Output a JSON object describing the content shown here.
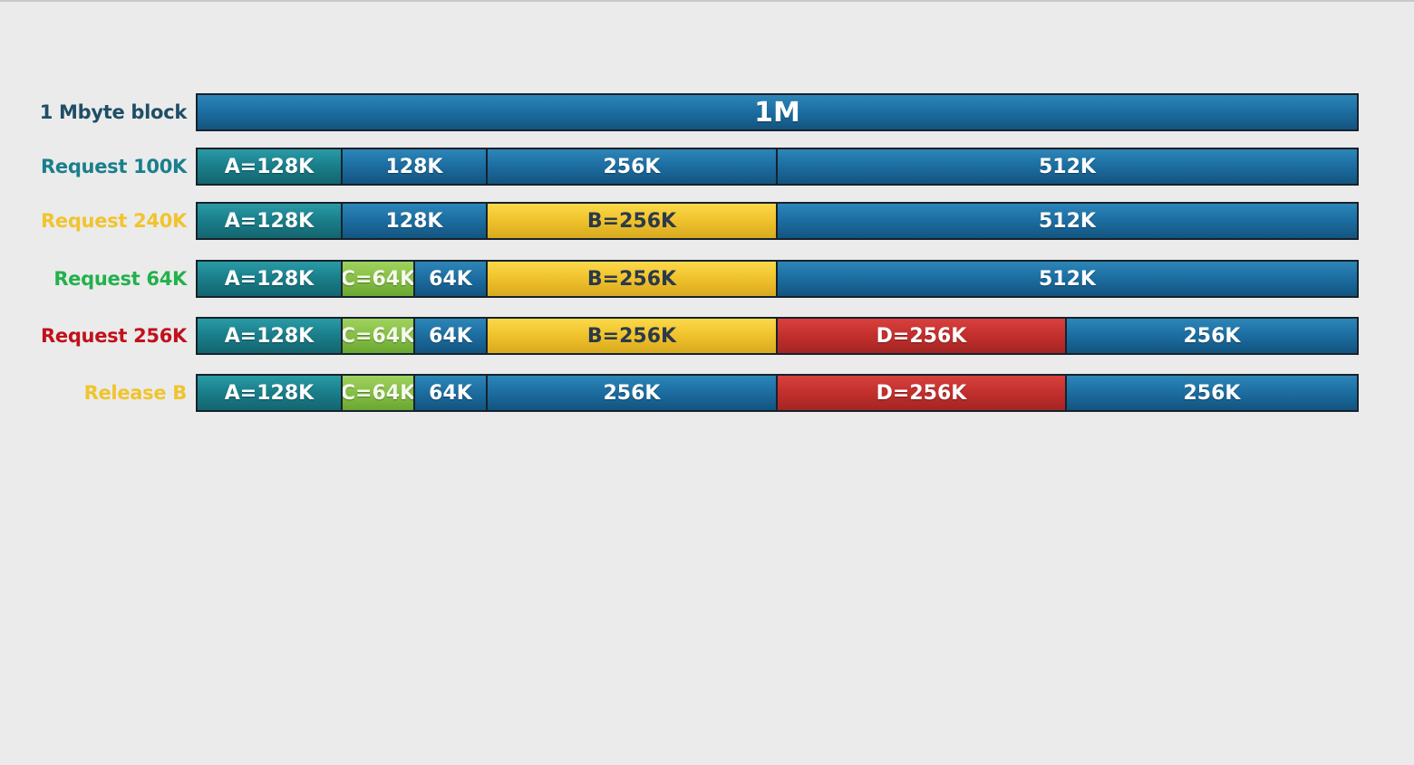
{
  "colors": {
    "free": "#1d6fa3",
    "allocated": "#1a808c",
    "B": "#efc22c",
    "C": "#86bf45",
    "D": "#c22f2d",
    "border": "#16222c",
    "background": "#ebebeb"
  },
  "rows": [
    {
      "label": "1 Mbyte block",
      "label_color": "#1f4e66",
      "segments": [
        {
          "text": "1M",
          "size_k": 1024,
          "kind": "free"
        }
      ]
    },
    {
      "label": "Request 100K",
      "label_color": "#1a7f8c",
      "segments": [
        {
          "text": "A=128K",
          "size_k": 128,
          "kind": "alloc"
        },
        {
          "text": "128K",
          "size_k": 128,
          "kind": "free"
        },
        {
          "text": "256K",
          "size_k": 256,
          "kind": "free"
        },
        {
          "text": "512K",
          "size_k": 512,
          "kind": "free"
        }
      ]
    },
    {
      "label": "Request 240K",
      "label_color": "#f0c42f",
      "segments": [
        {
          "text": "A=128K",
          "size_k": 128,
          "kind": "alloc"
        },
        {
          "text": "128K",
          "size_k": 128,
          "kind": "free"
        },
        {
          "text": "B=256K",
          "size_k": 256,
          "kind": "yellow"
        },
        {
          "text": "512K",
          "size_k": 512,
          "kind": "free"
        }
      ]
    },
    {
      "label": "Request 64K",
      "label_color": "#22b14c",
      "segments": [
        {
          "text": "A=128K",
          "size_k": 128,
          "kind": "alloc"
        },
        {
          "text": "C=64K",
          "size_k": 64,
          "kind": "green"
        },
        {
          "text": "64K",
          "size_k": 64,
          "kind": "free"
        },
        {
          "text": "B=256K",
          "size_k": 256,
          "kind": "yellow"
        },
        {
          "text": "512K",
          "size_k": 512,
          "kind": "free"
        }
      ]
    },
    {
      "label": "Request 256K",
      "label_color": "#c0121c",
      "segments": [
        {
          "text": "A=128K",
          "size_k": 128,
          "kind": "alloc"
        },
        {
          "text": "C=64K",
          "size_k": 64,
          "kind": "green"
        },
        {
          "text": "64K",
          "size_k": 64,
          "kind": "free"
        },
        {
          "text": "B=256K",
          "size_k": 256,
          "kind": "yellow"
        },
        {
          "text": "D=256K",
          "size_k": 256,
          "kind": "red"
        },
        {
          "text": "256K",
          "size_k": 256,
          "kind": "free"
        }
      ]
    },
    {
      "label": "Release B",
      "label_color": "#f0c42f",
      "segments": [
        {
          "text": "A=128K",
          "size_k": 128,
          "kind": "alloc"
        },
        {
          "text": "C=64K",
          "size_k": 64,
          "kind": "green"
        },
        {
          "text": "64K",
          "size_k": 64,
          "kind": "free"
        },
        {
          "text": "256K",
          "size_k": 256,
          "kind": "free"
        },
        {
          "text": "D=256K",
          "size_k": 256,
          "kind": "red"
        },
        {
          "text": "256K",
          "size_k": 256,
          "kind": "free"
        }
      ]
    }
  ]
}
